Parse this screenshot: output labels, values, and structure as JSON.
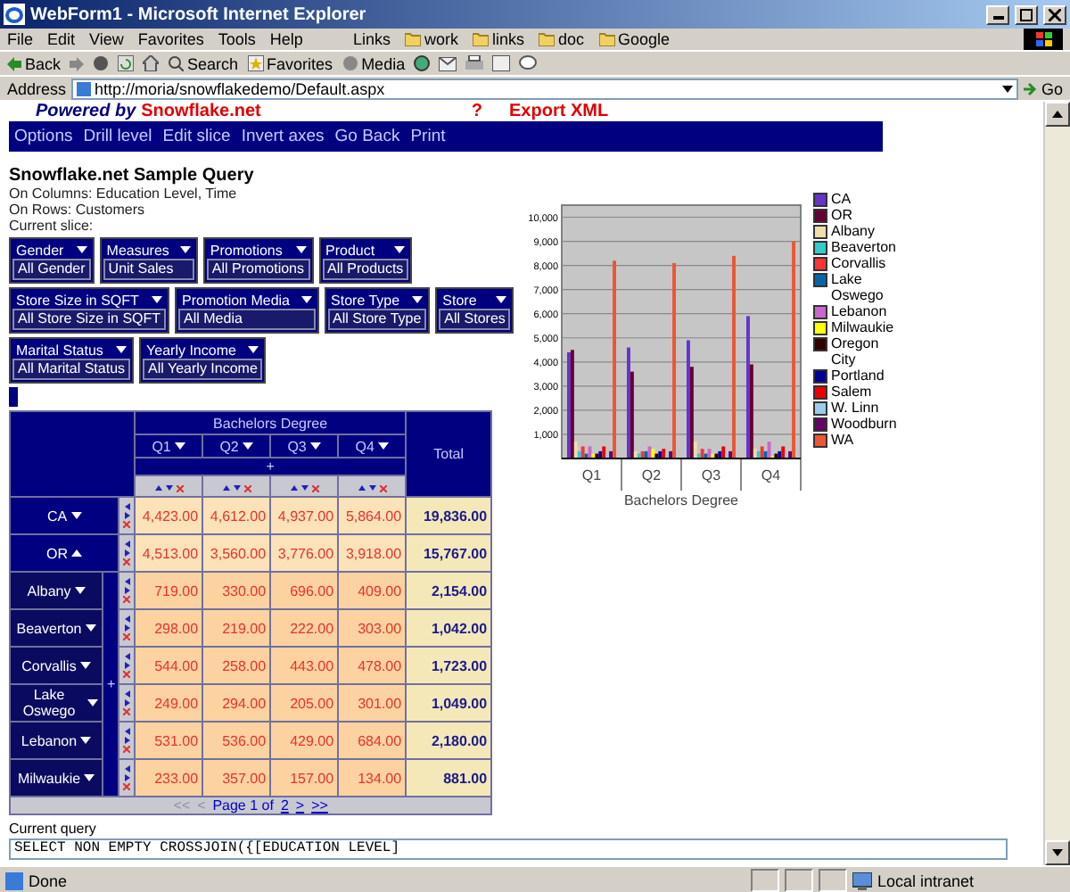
{
  "window": {
    "title": "WebForm1 - Microsoft Internet Explorer"
  },
  "menu": [
    "File",
    "Edit",
    "View",
    "Favorites",
    "Tools",
    "Help"
  ],
  "links": {
    "label": "Links",
    "items": [
      "work",
      "links",
      "doc",
      "Google"
    ]
  },
  "toolbar": [
    "Back",
    "Search",
    "Favorites",
    "Media"
  ],
  "address": {
    "label": "Address",
    "url": "http://moria/snowflakedemo/Default.aspx",
    "go": "Go"
  },
  "header": {
    "powered_by": "Powered by",
    "brand": "Snowflake.net",
    "help": "?",
    "export": "Export XML"
  },
  "nav": [
    "Options",
    "Drill level",
    "Edit slice",
    "Invert axes",
    "Go Back",
    "Print"
  ],
  "query_info": {
    "title": "Snowflake.net Sample Query",
    "lines": [
      "On Columns: Education Level, Time",
      "On Rows: Customers",
      "Current slice:"
    ]
  },
  "slicer_rows": [
    [
      {
        "name": "Gender",
        "value": "All Gender"
      },
      {
        "name": "Measures",
        "value": "Unit Sales"
      },
      {
        "name": "Promotions",
        "value": "All Promotions"
      },
      {
        "name": "Product",
        "value": "All Products"
      }
    ],
    [
      {
        "name": "Store Size in SQFT",
        "value": "All Store Size in SQFT"
      },
      {
        "name": "Promotion Media",
        "value": "All Media"
      },
      {
        "name": "Store Type",
        "value": "All Store Type"
      },
      {
        "name": "Store",
        "value": "All Stores"
      }
    ],
    [
      {
        "name": "Marital Status",
        "value": "All Marital Status"
      },
      {
        "name": "Yearly Income",
        "value": "All Yearly Income"
      }
    ]
  ],
  "table": {
    "column_group": "Bachelors Degree",
    "columns": [
      "Q1",
      "Q2",
      "Q3",
      "Q4"
    ],
    "expand_marker": "+",
    "total_label": "Total",
    "city_marker": "+",
    "rows": [
      {
        "label": "CA",
        "kind": "state",
        "expanded": false,
        "values": [
          "4,423.00",
          "4,612.00",
          "4,937.00",
          "5,864.00"
        ],
        "total": "19,836.00"
      },
      {
        "label": "OR",
        "kind": "state",
        "expanded": true,
        "values": [
          "4,513.00",
          "3,560.00",
          "3,776.00",
          "3,918.00"
        ],
        "total": "15,767.00"
      },
      {
        "label": "Albany",
        "kind": "city",
        "expanded": false,
        "values": [
          "719.00",
          "330.00",
          "696.00",
          "409.00"
        ],
        "total": "2,154.00"
      },
      {
        "label": "Beaverton",
        "kind": "city",
        "expanded": false,
        "values": [
          "298.00",
          "219.00",
          "222.00",
          "303.00"
        ],
        "total": "1,042.00"
      },
      {
        "label": "Corvallis",
        "kind": "city",
        "expanded": false,
        "values": [
          "544.00",
          "258.00",
          "443.00",
          "478.00"
        ],
        "total": "1,723.00"
      },
      {
        "label": "Lake Oswego",
        "kind": "city",
        "expanded": false,
        "values": [
          "249.00",
          "294.00",
          "205.00",
          "301.00"
        ],
        "total": "1,049.00"
      },
      {
        "label": "Lebanon",
        "kind": "city",
        "expanded": false,
        "values": [
          "531.00",
          "536.00",
          "429.00",
          "684.00"
        ],
        "total": "2,180.00"
      },
      {
        "label": "Milwaukie",
        "kind": "city",
        "expanded": false,
        "values": [
          "233.00",
          "357.00",
          "157.00",
          "134.00"
        ],
        "total": "881.00"
      }
    ],
    "pager": [
      {
        "text": "<<",
        "kind": "link",
        "disabled": true
      },
      {
        "text": "<",
        "kind": "link",
        "disabled": true
      },
      {
        "text": "Page 1 of",
        "kind": "label"
      },
      {
        "text": "2",
        "kind": "link",
        "disabled": false
      },
      {
        "text": ">",
        "kind": "link",
        "disabled": false
      },
      {
        "text": ">>",
        "kind": "link",
        "disabled": false
      }
    ]
  },
  "current_query": {
    "label": "Current query",
    "text": "SELECT NON EMPTY CROSSJOIN({[EDUCATION LEVEL]"
  },
  "chart": {
    "chart_data": {
      "type": "bar",
      "xlabel": "Bachelors Degree",
      "categories": [
        "Q1",
        "Q2",
        "Q3",
        "Q4"
      ],
      "ylim": [
        0,
        10500
      ],
      "grid": true,
      "legend": true,
      "yticks": [
        {
          "value": 1000,
          "label": "1,000"
        },
        {
          "value": 2000,
          "label": "2,000"
        },
        {
          "value": 3000,
          "label": "3,000"
        },
        {
          "value": 4000,
          "label": "4,000"
        },
        {
          "value": 5000,
          "label": "5,000"
        },
        {
          "value": 6000,
          "label": "6,000"
        },
        {
          "value": 7000,
          "label": "7,000"
        },
        {
          "value": 8000,
          "label": "8,000"
        },
        {
          "value": 9000,
          "label": "9,000"
        },
        {
          "value": 10000,
          "label": "10,000"
        }
      ],
      "series": [
        {
          "name": "CA",
          "color": "#6633cc",
          "values": [
            4400,
            4600,
            4900,
            5900
          ]
        },
        {
          "name": "OR",
          "color": "#660033",
          "values": [
            4500,
            3600,
            3800,
            3900
          ]
        },
        {
          "name": "Albany",
          "color": "#eeddaa",
          "values": [
            700,
            300,
            700,
            400
          ]
        },
        {
          "name": "Beaverton",
          "color": "#33cccc",
          "values": [
            300,
            200,
            200,
            300
          ]
        },
        {
          "name": "Corvallis",
          "color": "#ff3333",
          "values": [
            500,
            300,
            400,
            500
          ]
        },
        {
          "name": "Lake Oswego",
          "color": "#0066aa",
          "values": [
            200,
            300,
            200,
            300
          ]
        },
        {
          "name": "Lebanon",
          "color": "#cc66cc",
          "values": [
            500,
            500,
            400,
            700
          ]
        },
        {
          "name": "Milwaukie",
          "color": "#ffff00",
          "values": [
            200,
            400,
            200,
            100
          ]
        },
        {
          "name": "Oregon City",
          "color": "#330000",
          "values": [
            200,
            200,
            200,
            200
          ]
        },
        {
          "name": "Portland",
          "color": "#000099",
          "values": [
            300,
            300,
            300,
            300
          ]
        },
        {
          "name": "Salem",
          "color": "#ee0000",
          "values": [
            500,
            400,
            500,
            500
          ]
        },
        {
          "name": "W. Linn",
          "color": "#99ccee",
          "values": [
            200,
            200,
            200,
            200
          ]
        },
        {
          "name": "Woodburn",
          "color": "#660066",
          "values": [
            300,
            300,
            300,
            300
          ]
        },
        {
          "name": "WA",
          "color": "#ee5533",
          "values": [
            8200,
            8100,
            8400,
            9000
          ]
        }
      ]
    }
  },
  "status_bar": {
    "text": "Done",
    "zone": "Local intranet"
  }
}
